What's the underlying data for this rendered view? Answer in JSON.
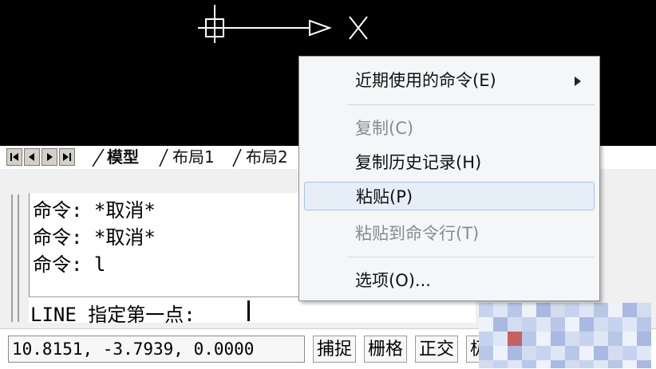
{
  "tabs": {
    "model": "模型",
    "layout1": "布局1",
    "layout2": "布局2"
  },
  "command_history": [
    "命令: *取消*",
    "命令: *取消*",
    "命令: l"
  ],
  "command_prompt": "LINE 指定第一点:",
  "statusbar": {
    "coordinates": "10.8151, -3.7939, 0.0000",
    "snap": "捕捉",
    "grid": "栅格",
    "ortho": "正交",
    "polar_partial": "极"
  },
  "context_menu": {
    "recent_commands": "近期使用的命令(E)",
    "copy": "复制(C)",
    "copy_history": "复制历史记录(H)",
    "paste": "粘贴(P)",
    "paste_to_cmdline": "粘贴到命令行(T)",
    "options": "选项(O)..."
  },
  "colors": {
    "viewport_background": "#000000",
    "menu_background": "#f5f6f7",
    "menu_hover": "#e6eef8",
    "disabled_text": "#8a8a8a"
  },
  "icons": {
    "ucs": "ucs-crosshair-icon",
    "nav_first": "first-tab-icon",
    "nav_prev": "prev-tab-icon",
    "nav_next": "next-tab-icon",
    "nav_last": "last-tab-icon",
    "submenu": "submenu-arrow-icon"
  }
}
